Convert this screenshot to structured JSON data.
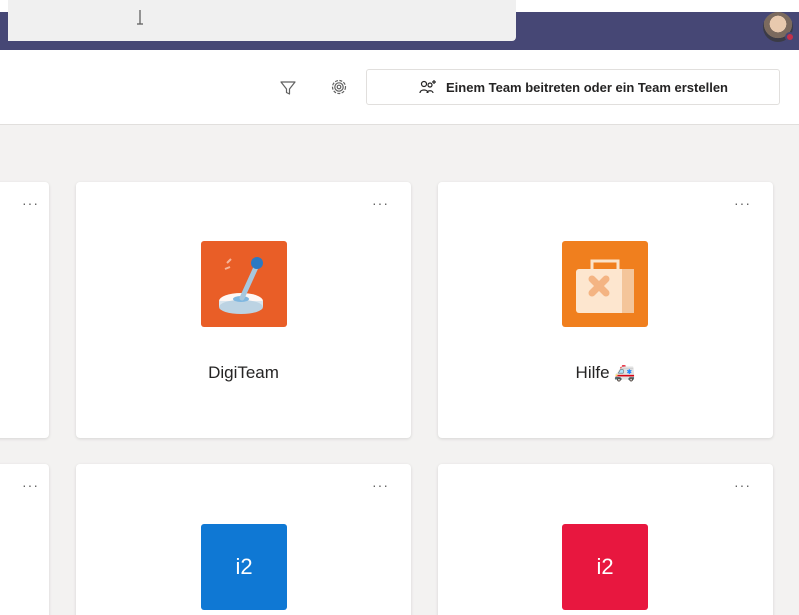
{
  "titlebar": {
    "bg_color": "#464775",
    "search_caret_icon": "text-cursor-icon",
    "avatar_icon": "user-avatar",
    "presence_color": "#c4314b"
  },
  "toolbar": {
    "filter_icon": "filter-icon",
    "settings_icon": "gear-icon",
    "join_button_icon": "team-add-icon",
    "join_button_label": "Einem Team beitreten oder ein Team erstellen"
  },
  "teams": [
    {
      "name": "",
      "more_label": "···",
      "tile_color": "#ffffff"
    },
    {
      "name": "DigiTeam",
      "more_label": "···",
      "tile_color": "#e95e27",
      "icon": "joystick-icon"
    },
    {
      "name": "Hilfe 🚑",
      "more_label": "···",
      "tile_color": "#f07f1e",
      "icon": "first-aid-kit-icon"
    },
    {
      "name": "",
      "more_label": "···",
      "tile_color": "#ffffff"
    },
    {
      "name": "",
      "more_label": "···",
      "tile_color": "#0f78d4",
      "tile_text": "i2"
    },
    {
      "name": "",
      "more_label": "···",
      "tile_color": "#e8173f",
      "tile_text": "i2"
    }
  ]
}
